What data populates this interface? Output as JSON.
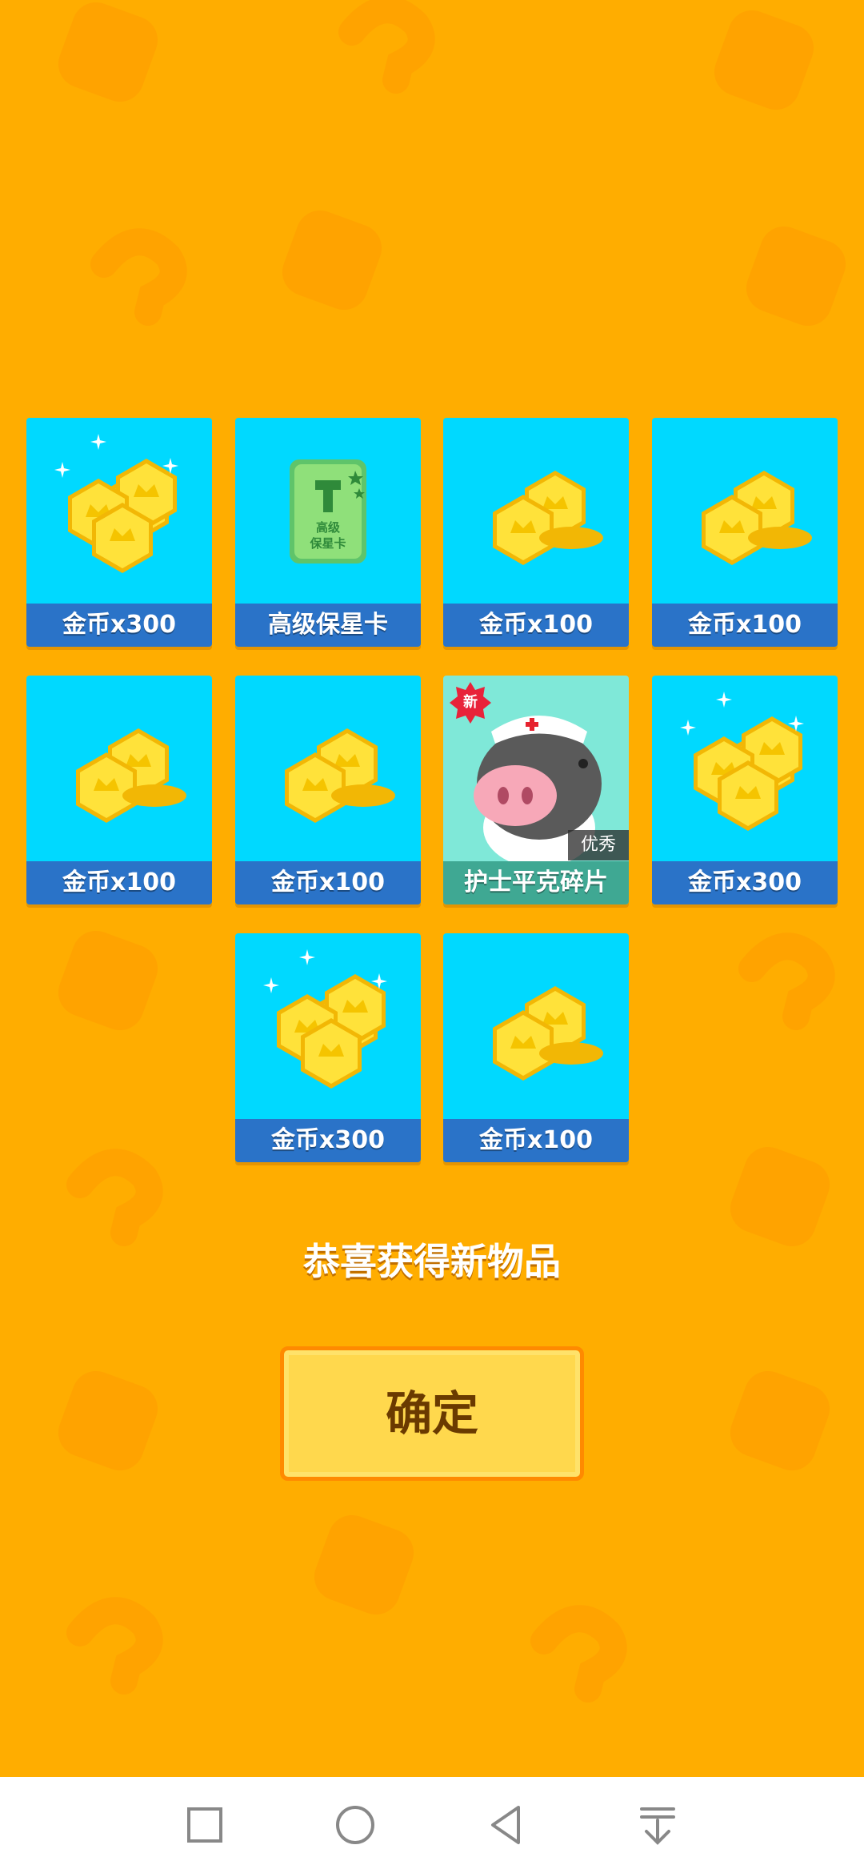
{
  "rewards": [
    {
      "label": "金币x300",
      "art": "coins-large-icon"
    },
    {
      "label": "高级保星卡",
      "art": "star-protect-card-icon",
      "card_text": "高级\n保星卡"
    },
    {
      "label": "金币x100",
      "art": "coins-small-icon"
    },
    {
      "label": "金币x100",
      "art": "coins-small-icon"
    },
    {
      "label": "金币x100",
      "art": "coins-small-icon"
    },
    {
      "label": "金币x100",
      "art": "coins-small-icon"
    },
    {
      "label": "护士平克碎片",
      "art": "nurse-pig-icon",
      "badge": "新",
      "rank": "优秀"
    },
    {
      "label": "金币x300",
      "art": "coins-large-icon"
    },
    {
      "label": "金币x300",
      "art": "coins-large-icon"
    },
    {
      "label": "金币x100",
      "art": "coins-small-icon"
    }
  ],
  "message": "恭喜获得新物品",
  "confirm_label": "确定",
  "nav": {
    "icons": [
      "square-recents-icon",
      "circle-home-icon",
      "triangle-back-icon",
      "download-arrow-icon"
    ]
  },
  "colors": {
    "background": "#ffad00",
    "card": "#00d9ff",
    "label_bar": "#2a73c8",
    "button": "#ffd84d"
  }
}
